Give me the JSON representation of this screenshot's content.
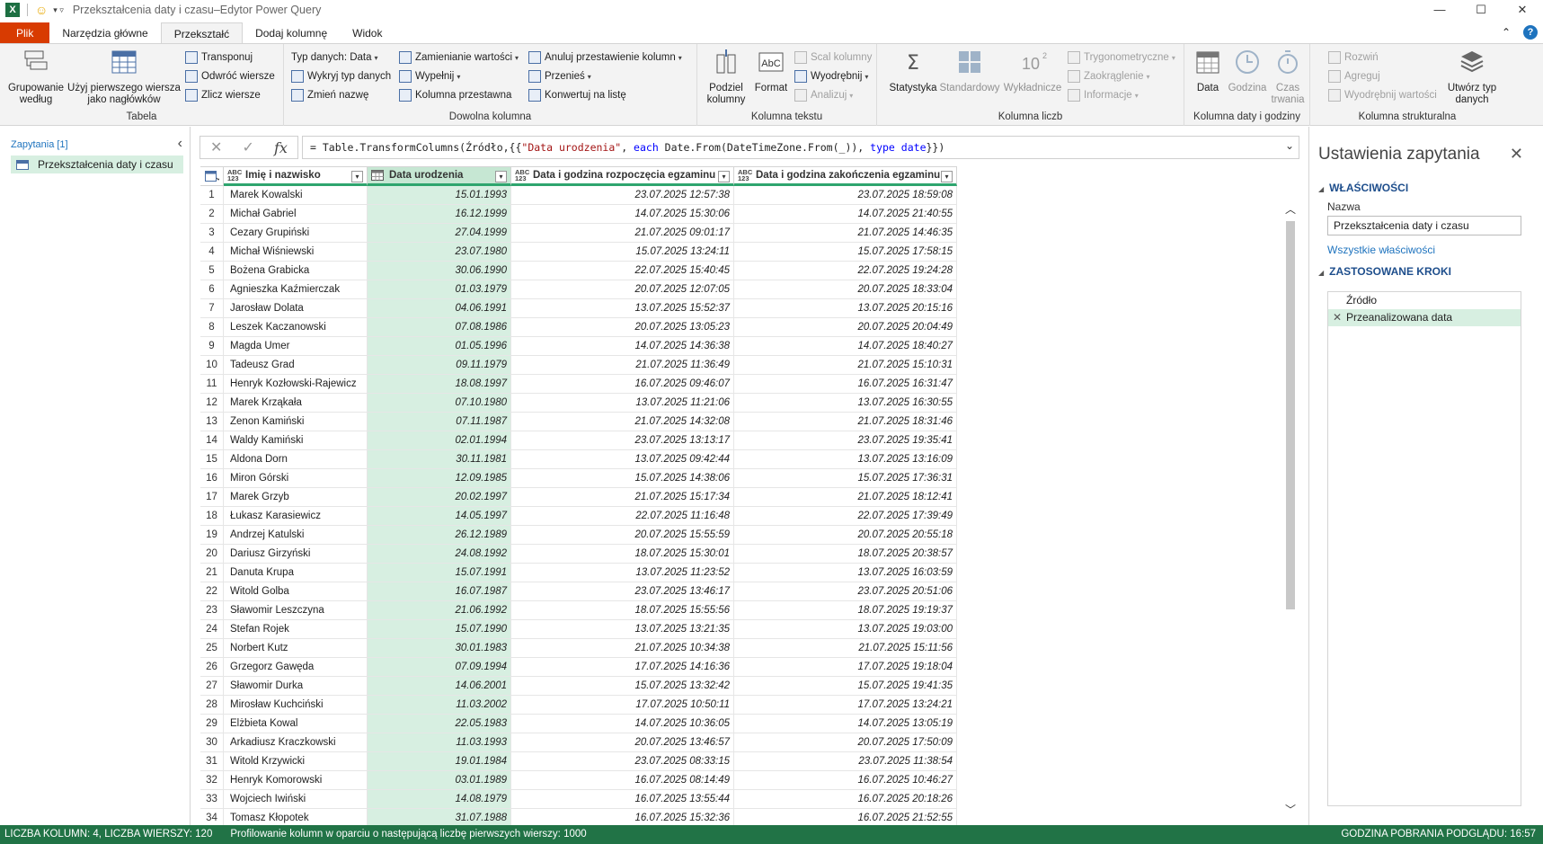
{
  "window": {
    "title": "Przekształcenia daty i czasu–Edytor Power Query",
    "app_icon": "excel-icon",
    "smiley": "☺",
    "min": "—",
    "max": "☐",
    "close": "✕"
  },
  "tabs": [
    {
      "label": "Plik"
    },
    {
      "label": "Narzędzia główne"
    },
    {
      "label": "Przekształć"
    },
    {
      "label": "Dodaj kolumnę"
    },
    {
      "label": "Widok"
    }
  ],
  "tabs_right": {
    "caret": "⌃",
    "help": "?"
  },
  "ribbon": {
    "tabela": {
      "label": "Tabela",
      "grupowanie": "Grupowanie według",
      "naglowki": "Użyj pierwszego wiersza jako nagłówków",
      "transponuj": "Transponuj",
      "odwroc": "Odwróć wiersze",
      "zlicz": "Zlicz wiersze"
    },
    "dowolna": {
      "label": "Dowolna kolumna",
      "typ_danych": "Typ danych: Data",
      "wykryj": "Wykryj typ danych",
      "zmien_nazwe": "Zmień nazwę",
      "zamienianie": "Zamienianie wartości",
      "wypelnij": "Wypełnij",
      "kolumna_przestawna": "Kolumna przestawna",
      "anuluj": "Anuluj przestawienie kolumn",
      "przenies": "Przenieś",
      "konwertuj": "Konwertuj na listę"
    },
    "tekst": {
      "label": "Kolumna tekstu",
      "podziel": "Podziel kolumny",
      "format": "Format",
      "scal": "Scal kolumny",
      "wyodrebnij": "Wyodrębnij",
      "analizuj": "Analizuj"
    },
    "liczby": {
      "label": "Kolumna liczb",
      "statystyka": "Statystyka",
      "standardowy": "Standardowy",
      "wykladnicze": "Wykładnicze",
      "trygonometryczne": "Trygonometryczne",
      "zaokraglenie": "Zaokrąglenie",
      "informacje": "Informacje"
    },
    "daty": {
      "label": "Kolumna daty i godziny",
      "data": "Data",
      "godzina": "Godzina",
      "czas_trwania": "Czas trwania"
    },
    "strukturalna": {
      "label": "Kolumna strukturalna",
      "rozwin": "Rozwiń",
      "agreguj": "Agreguj",
      "wyodrebnij_wartosci": "Wyodrębnij wartości",
      "utworz_typ": "Utwórz typ danych"
    }
  },
  "queries": {
    "header": "Zapytania [1]",
    "items": [
      {
        "label": "Przekształcenia daty i czasu"
      }
    ],
    "collapse": "‹"
  },
  "formula_bar": {
    "cancel": "✕",
    "confirm": "✓",
    "fx": "fx",
    "expand": "⌄",
    "p1": "= Table.TransformColumns(Źródło,{{",
    "p2": "\"Data urodzenia\"",
    "p3": ", ",
    "p4": "each",
    "p5": " Date.From(DateTimeZone.From(_)), ",
    "p6": "type",
    "p7": " ",
    "p8": "date",
    "p9": "}})"
  },
  "grid": {
    "corner_icon": "table-icon",
    "columns": [
      {
        "type": "ABC\n123",
        "label": "Imię i nazwisko"
      },
      {
        "type": "date",
        "label": "Data urodzenia"
      },
      {
        "type": "ABC\n123",
        "label": "Data i godzina rozpoczęcia egzaminu"
      },
      {
        "type": "ABC\n123",
        "label": "Data i godzina zakończenia egzaminu"
      }
    ],
    "filter": "▾",
    "rows": [
      [
        "1",
        "Marek Kowalski",
        "15.01.1993",
        "23.07.2025 12:57:38",
        "23.07.2025 18:59:08"
      ],
      [
        "2",
        "Michał Gabriel",
        "16.12.1999",
        "14.07.2025 15:30:06",
        "14.07.2025 21:40:55"
      ],
      [
        "3",
        "Cezary Grupiński",
        "27.04.1999",
        "21.07.2025 09:01:17",
        "21.07.2025 14:46:35"
      ],
      [
        "4",
        "Michał Wiśniewski",
        "23.07.1980",
        "15.07.2025 13:24:11",
        "15.07.2025 17:58:15"
      ],
      [
        "5",
        "Bożena Grabicka",
        "30.06.1990",
        "22.07.2025 15:40:45",
        "22.07.2025 19:24:28"
      ],
      [
        "6",
        "Agnieszka Kaźmierczak",
        "01.03.1979",
        "20.07.2025 12:07:05",
        "20.07.2025 18:33:04"
      ],
      [
        "7",
        "Jarosław Dolata",
        "04.06.1991",
        "13.07.2025 15:52:37",
        "13.07.2025 20:15:16"
      ],
      [
        "8",
        "Leszek Kaczanowski",
        "07.08.1986",
        "20.07.2025 13:05:23",
        "20.07.2025 20:04:49"
      ],
      [
        "9",
        "Magda Umer",
        "01.05.1996",
        "14.07.2025 14:36:38",
        "14.07.2025 18:40:27"
      ],
      [
        "10",
        "Tadeusz Grad",
        "09.11.1979",
        "21.07.2025 11:36:49",
        "21.07.2025 15:10:31"
      ],
      [
        "11",
        "Henryk Kozłowski-Rajewicz",
        "18.08.1997",
        "16.07.2025 09:46:07",
        "16.07.2025 16:31:47"
      ],
      [
        "12",
        "Marek Krząkała",
        "07.10.1980",
        "13.07.2025 11:21:06",
        "13.07.2025 16:30:55"
      ],
      [
        "13",
        "Zenon Kamiński",
        "07.11.1987",
        "21.07.2025 14:32:08",
        "21.07.2025 18:31:46"
      ],
      [
        "14",
        "Waldy Kamiński",
        "02.01.1994",
        "23.07.2025 13:13:17",
        "23.07.2025 19:35:41"
      ],
      [
        "15",
        "Aldona Dorn",
        "30.11.1981",
        "13.07.2025 09:42:44",
        "13.07.2025 13:16:09"
      ],
      [
        "16",
        "Miron Górski",
        "12.09.1985",
        "15.07.2025 14:38:06",
        "15.07.2025 17:36:31"
      ],
      [
        "17",
        "Marek Grzyb",
        "20.02.1997",
        "21.07.2025 15:17:34",
        "21.07.2025 18:12:41"
      ],
      [
        "18",
        "Łukasz Karasiewicz",
        "14.05.1997",
        "22.07.2025 11:16:48",
        "22.07.2025 17:39:49"
      ],
      [
        "19",
        "Andrzej Katulski",
        "26.12.1989",
        "20.07.2025 15:55:59",
        "20.07.2025 20:55:18"
      ],
      [
        "20",
        "Dariusz Girzyński",
        "24.08.1992",
        "18.07.2025 15:30:01",
        "18.07.2025 20:38:57"
      ],
      [
        "21",
        "Danuta Krupa",
        "15.07.1991",
        "13.07.2025 11:23:52",
        "13.07.2025 16:03:59"
      ],
      [
        "22",
        "Witold Golba",
        "16.07.1987",
        "23.07.2025 13:46:17",
        "23.07.2025 20:51:06"
      ],
      [
        "23",
        "Sławomir Leszczyna",
        "21.06.1992",
        "18.07.2025 15:55:56",
        "18.07.2025 19:19:37"
      ],
      [
        "24",
        "Stefan Rojek",
        "15.07.1990",
        "13.07.2025 13:21:35",
        "13.07.2025 19:03:00"
      ],
      [
        "25",
        "Norbert Kutz",
        "30.01.1983",
        "21.07.2025 10:34:38",
        "21.07.2025 15:11:56"
      ],
      [
        "26",
        "Grzegorz Gawęda",
        "07.09.1994",
        "17.07.2025 14:16:36",
        "17.07.2025 19:18:04"
      ],
      [
        "27",
        "Sławomir Durka",
        "14.06.2001",
        "15.07.2025 13:32:42",
        "15.07.2025 19:41:35"
      ],
      [
        "28",
        "Mirosław Kuchciński",
        "11.03.2002",
        "17.07.2025 10:50:11",
        "17.07.2025 13:24:21"
      ],
      [
        "29",
        "Elżbieta Kowal",
        "22.05.1983",
        "14.07.2025 10:36:05",
        "14.07.2025 13:05:19"
      ],
      [
        "30",
        "Arkadiusz Kraczkowski",
        "11.03.1993",
        "20.07.2025 13:46:57",
        "20.07.2025 17:50:09"
      ],
      [
        "31",
        "Witold Krzywicki",
        "19.01.1984",
        "23.07.2025 08:33:15",
        "23.07.2025 11:38:54"
      ],
      [
        "32",
        "Henryk Komorowski",
        "03.01.1989",
        "16.07.2025 08:14:49",
        "16.07.2025 10:46:27"
      ],
      [
        "33",
        "Wojciech Iwiński",
        "14.08.1979",
        "16.07.2025 13:55:44",
        "16.07.2025 20:18:26"
      ],
      [
        "34",
        "Tomasz Kłopotek",
        "31.07.1988",
        "16.07.2025 15:32:36",
        "16.07.2025 21:52:55"
      ]
    ]
  },
  "scroll": {
    "up": "︿",
    "down": "﹀"
  },
  "settings": {
    "title": "Ustawienia zapytania",
    "close": "✕",
    "properties_header": "WŁAŚCIWOŚCI",
    "name_label": "Nazwa",
    "name_value": "Przekształcenia daty i czasu",
    "all_properties": "Wszystkie właściwości",
    "steps_header": "ZASTOSOWANE KROKI",
    "steps": [
      {
        "label": "Źródło"
      },
      {
        "label": "Przeanalizowana data",
        "delete": "✕"
      }
    ]
  },
  "status": {
    "left": "LICZBA KOLUMN: 4, LICZBA WIERSZY: 120",
    "middle": "Profilowanie kolumn w oparciu o następującą liczbę pierwszych wierszy: 1000",
    "right": "GODZINA POBRANIA PODGLĄDU: 16:57"
  },
  "colors": {
    "accent": "#217346",
    "selected_column": "#d7efe1",
    "file_tab": "#d83b01"
  }
}
